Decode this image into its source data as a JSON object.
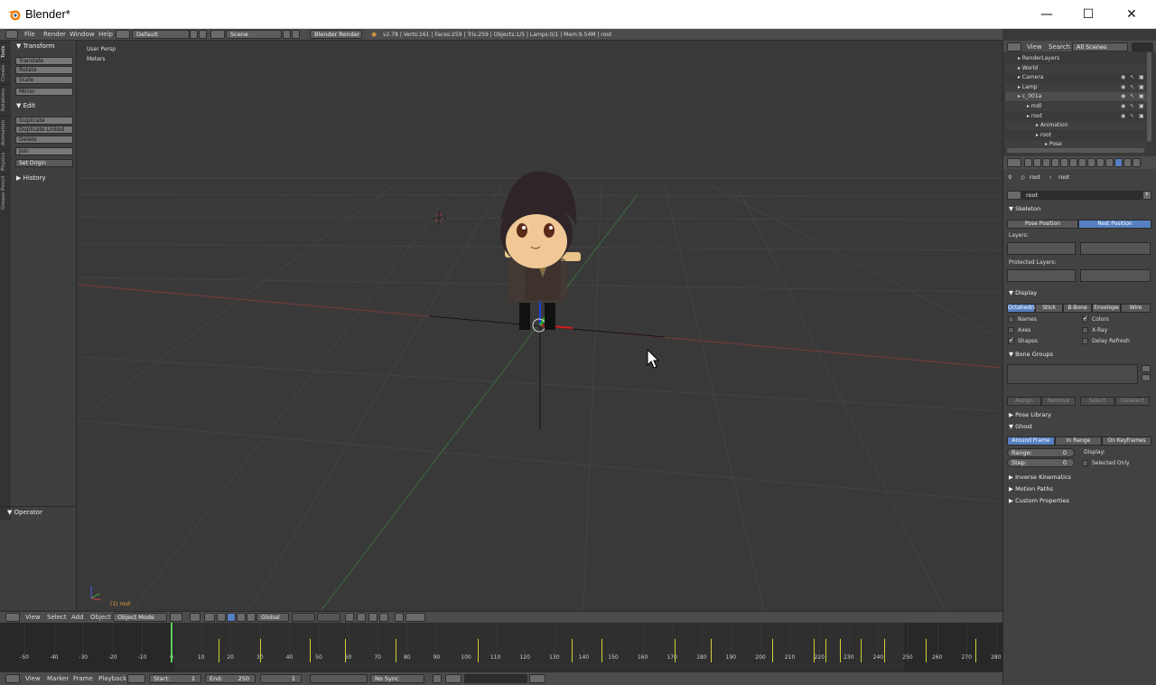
{
  "window": {
    "title": "Blender*",
    "min": "—",
    "max": "☐",
    "close": "✕"
  },
  "info_header": {
    "menus": [
      "File",
      "Render",
      "Window",
      "Help"
    ],
    "layout": "Default",
    "scene": "Scene",
    "engine": "Blender Render",
    "stats": "v2.78 | Verts:161 | Faces:259 | Tris:259 | Objects:1/5 | Lamps:0/1 | Mem:9.54M | root"
  },
  "tools": {
    "tabs": [
      "Tools",
      "Create",
      "Relations",
      "Animation",
      "Physics",
      "Grease Pencil"
    ],
    "transform_header": "Transform",
    "transform_buttons": [
      "Translate",
      "Rotate",
      "Scale"
    ],
    "mirror": "Mirror",
    "edit_header": "Edit",
    "edit_buttons": [
      "Duplicate",
      "Duplicate Linked",
      "Delete"
    ],
    "join": "Join",
    "set_origin": "Set Origin",
    "history_header": "History",
    "operator_header": "Operator"
  },
  "viewport": {
    "view_name": "User Persp",
    "units": "Meters",
    "object_label": "(1) root"
  },
  "view3d_header": {
    "menus": [
      "View",
      "Select",
      "Add",
      "Object"
    ],
    "mode": "Object Mode",
    "orientation": "Global"
  },
  "timeline": {
    "ticks": [
      "-50",
      "-40",
      "-30",
      "-20",
      "-10",
      "0",
      "10",
      "20",
      "30",
      "40",
      "50",
      "60",
      "70",
      "80",
      "90",
      "100",
      "110",
      "120",
      "130",
      "140",
      "150",
      "160",
      "170",
      "180",
      "190",
      "200",
      "210",
      "220",
      "230",
      "240",
      "250",
      "260",
      "270",
      "280"
    ],
    "keyframes": [
      16,
      30,
      47,
      59,
      76,
      104,
      136,
      146,
      171,
      183,
      204,
      218,
      222,
      227,
      234,
      242,
      256,
      273
    ],
    "playhead": 0,
    "end": 250
  },
  "timeline_header": {
    "menus": [
      "View",
      "Marker",
      "Frame",
      "Playback"
    ],
    "start_label": "Start:",
    "start": "1",
    "end_label": "End:",
    "end": "250",
    "current": "1",
    "sync": "No Sync"
  },
  "outliner": {
    "menus": [
      "View",
      "Search"
    ],
    "scope": "All Scenes",
    "rows": [
      {
        "label": "RenderLayers",
        "indent": 1
      },
      {
        "label": "World",
        "indent": 1
      },
      {
        "label": "Camera",
        "indent": 1
      },
      {
        "label": "Lamp",
        "indent": 1
      },
      {
        "label": "c_001a",
        "indent": 1
      },
      {
        "label": "mdl",
        "indent": 2
      },
      {
        "label": "root",
        "indent": 2
      },
      {
        "label": "Animation",
        "indent": 3
      },
      {
        "label": "root",
        "indent": 3
      },
      {
        "label": "Pose",
        "indent": 4
      }
    ]
  },
  "properties": {
    "breadcrumb": [
      "root",
      "root"
    ],
    "name_field": "root",
    "name_suffix": "F",
    "skeleton_header": "Skeleton",
    "pose_position": "Pose Position",
    "rest_position": "Rest Position",
    "layers_label": "Layers:",
    "protected_layers_label": "Protected Layers:",
    "display_header": "Display",
    "display_types": [
      "Octahedral",
      "Stick",
      "B-Bone",
      "Envelope",
      "Wire"
    ],
    "display_checks_left": [
      {
        "label": "Names",
        "on": false
      },
      {
        "label": "Axes",
        "on": false
      },
      {
        "label": "Shapes",
        "on": true
      }
    ],
    "display_checks_right": [
      {
        "label": "Colors",
        "on": true
      },
      {
        "label": "X-Ray",
        "on": false
      },
      {
        "label": "Delay Refresh",
        "on": false
      }
    ],
    "bone_groups_header": "Bone Groups",
    "bone_group_buttons": [
      "Assign",
      "Remove",
      "Select",
      "Deselect"
    ],
    "pose_library_header": "Pose Library",
    "ghost_header": "Ghost",
    "ghost_modes": [
      "Around Frame",
      "In Range",
      "On Keyframes"
    ],
    "range_label": "Range:",
    "range_value": "0",
    "step_label": "Step:",
    "step_value": "0",
    "display_label": "Display:",
    "selected_only": "Selected Only",
    "ik_header": "Inverse Kinematics",
    "motion_paths_header": "Motion Paths",
    "custom_props_header": "Custom Properties"
  }
}
